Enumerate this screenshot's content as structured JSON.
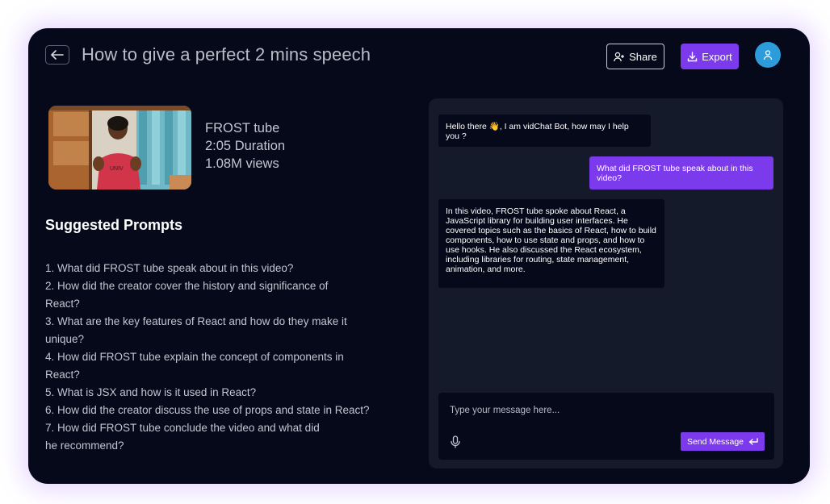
{
  "header": {
    "back_icon": "arrow-left-icon",
    "title": "How to give a perfect 2 mins speech",
    "share_label": "Share",
    "share_icon": "user-plus-icon",
    "export_label": "Export",
    "export_icon": "download-icon",
    "avatar_icon": "user-icon"
  },
  "video": {
    "channel": "FROST tube",
    "duration": "2:05 Duration",
    "views": "1.08M views"
  },
  "prompts": {
    "heading": "Suggested Prompts",
    "items": [
      "1. What did FROST tube speak about in this video?",
      "2. How did the creator cover the history and significance of React?",
      "3. What are the key features of React and how do they make it unique?",
      "4. How did FROST tube explain the concept of components in React?",
      "5. What is JSX and how is it used in React?",
      "6. How did the creator discuss the use of props and state in React?",
      "7. How did FROST tube conclude the video and what did he recommend?"
    ]
  },
  "chat": {
    "messages": [
      {
        "sender": "bot",
        "text": "Hello there 👋, I am vidChat Bot, how may I help you ?"
      },
      {
        "sender": "user",
        "text": "What did FROST tube speak about in this video?"
      },
      {
        "sender": "bot",
        "text": "In this video, FROST tube spoke about React, a JavaScript library for building user interfaces. He covered topics such as the basics of React, how to build components, how to use state and props, and how to use hooks. He also discussed the React ecosystem, including libraries for routing, state management, animation, and more."
      }
    ],
    "input_placeholder": "Type your message here...",
    "mic_icon": "microphone-icon",
    "send_label": "Send Message",
    "send_icon": "enter-icon"
  },
  "colors": {
    "background": "#05091a",
    "panel": "#141a29",
    "accent": "#7c3aed",
    "avatar": "#2d9cdb"
  }
}
